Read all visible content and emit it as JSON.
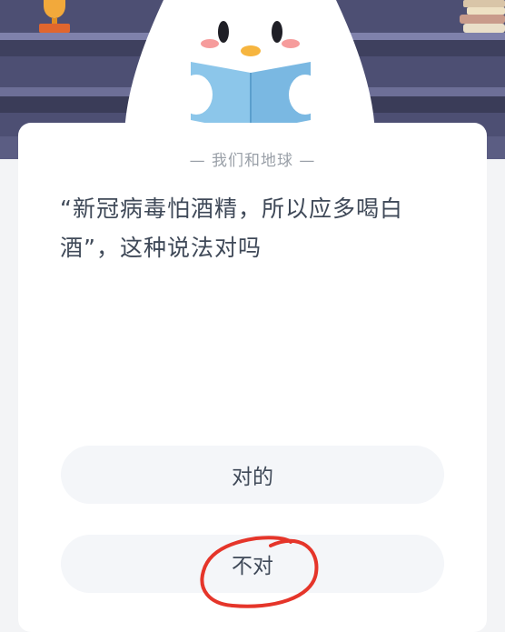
{
  "header": {
    "section_title": "— 我们和地球 —"
  },
  "question": {
    "text": "“新冠病毒怕酒精，所以应多喝白酒”，这种说法对吗"
  },
  "answers": [
    {
      "label": "对的"
    },
    {
      "label": "不对"
    }
  ],
  "annotation": {
    "shape": "hand-drawn circle",
    "color": "#e5352a",
    "target": "answer 2"
  },
  "colors": {
    "banner": "#4d4f73",
    "card": "#ffffff",
    "button": "#f4f6f9",
    "text": "#3f4958"
  }
}
